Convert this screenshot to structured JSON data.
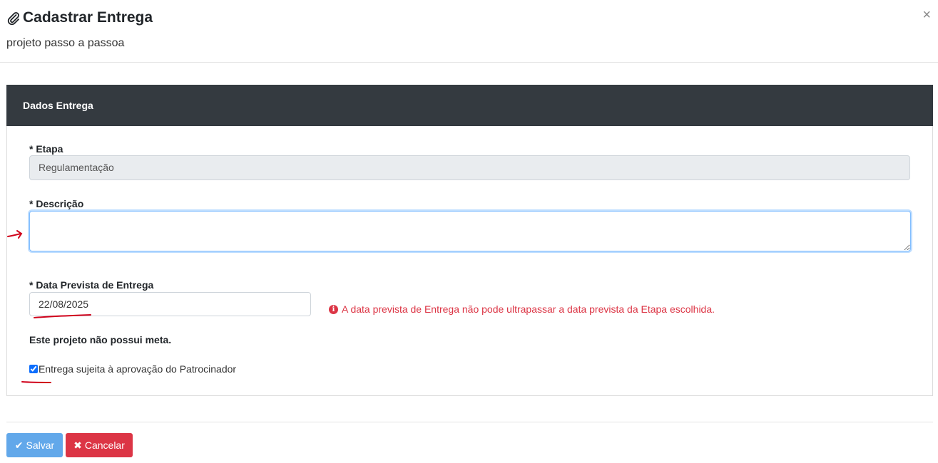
{
  "header": {
    "title": "Cadastrar Entrega",
    "subtitle": "projeto passo a passoa",
    "title_icon": "paperclip-icon",
    "close_label": "×"
  },
  "card": {
    "header_label": "Dados Entrega",
    "etapa": {
      "label": "* Etapa",
      "value": "Regulamentação"
    },
    "descricao": {
      "label": "* Descrição",
      "value": ""
    },
    "data_prevista": {
      "label": "* Data Prevista de Entrega",
      "value": "22/08/2025",
      "error": "A data prevista de Entrega não pode ultrapassar a data prevista da Etapa escolhida."
    },
    "meta_text": "Este projeto não possui meta.",
    "aprovacao": {
      "label": "Entrega sujeita à aprovação do Patrocinador",
      "checked": true
    }
  },
  "footer": {
    "save_label": "Salvar",
    "cancel_label": "Cancelar"
  },
  "colors": {
    "card_header_bg": "#343a40",
    "error": "#dc3545",
    "save_button": "#62a8ea",
    "cancel_button": "#dc3545",
    "annotation": "#d0021b"
  }
}
